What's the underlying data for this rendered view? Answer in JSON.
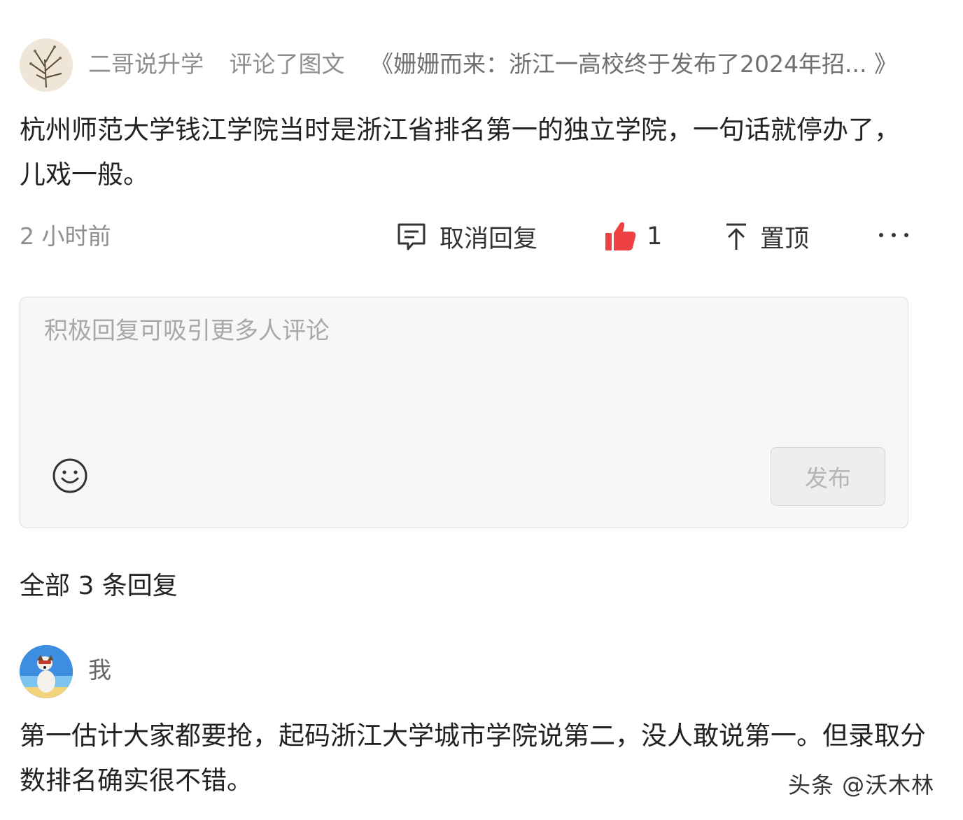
{
  "comment": {
    "author": "二哥说升学",
    "action": "评论了图文",
    "article": "《姗姗而来：浙江一高校终于发布了2024年招... 》",
    "text": "杭州师范大学钱江学院当时是浙江省排名第一的独立学院，一句话就停办了，儿戏一般。",
    "time": "2 小时前"
  },
  "actions": {
    "cancel_reply": "取消回复",
    "like_count": "1",
    "pin": "置顶",
    "more_icon": "more-dots-icon"
  },
  "reply_box": {
    "placeholder": "积极回复可吸引更多人评论",
    "value": "",
    "publish": "发布"
  },
  "replies_header": "全部 3 条回复",
  "reply": {
    "author": "我",
    "text": "第一估计大家都要抢，起码浙江大学城市学院说第二，没人敢说第一。但录取分数排名确实很不错。"
  },
  "watermark": "头条 @沃木林",
  "colors": {
    "like_red": "#f04142",
    "muted_text": "#8e8e8e",
    "box_bg": "#f7f7f8"
  }
}
